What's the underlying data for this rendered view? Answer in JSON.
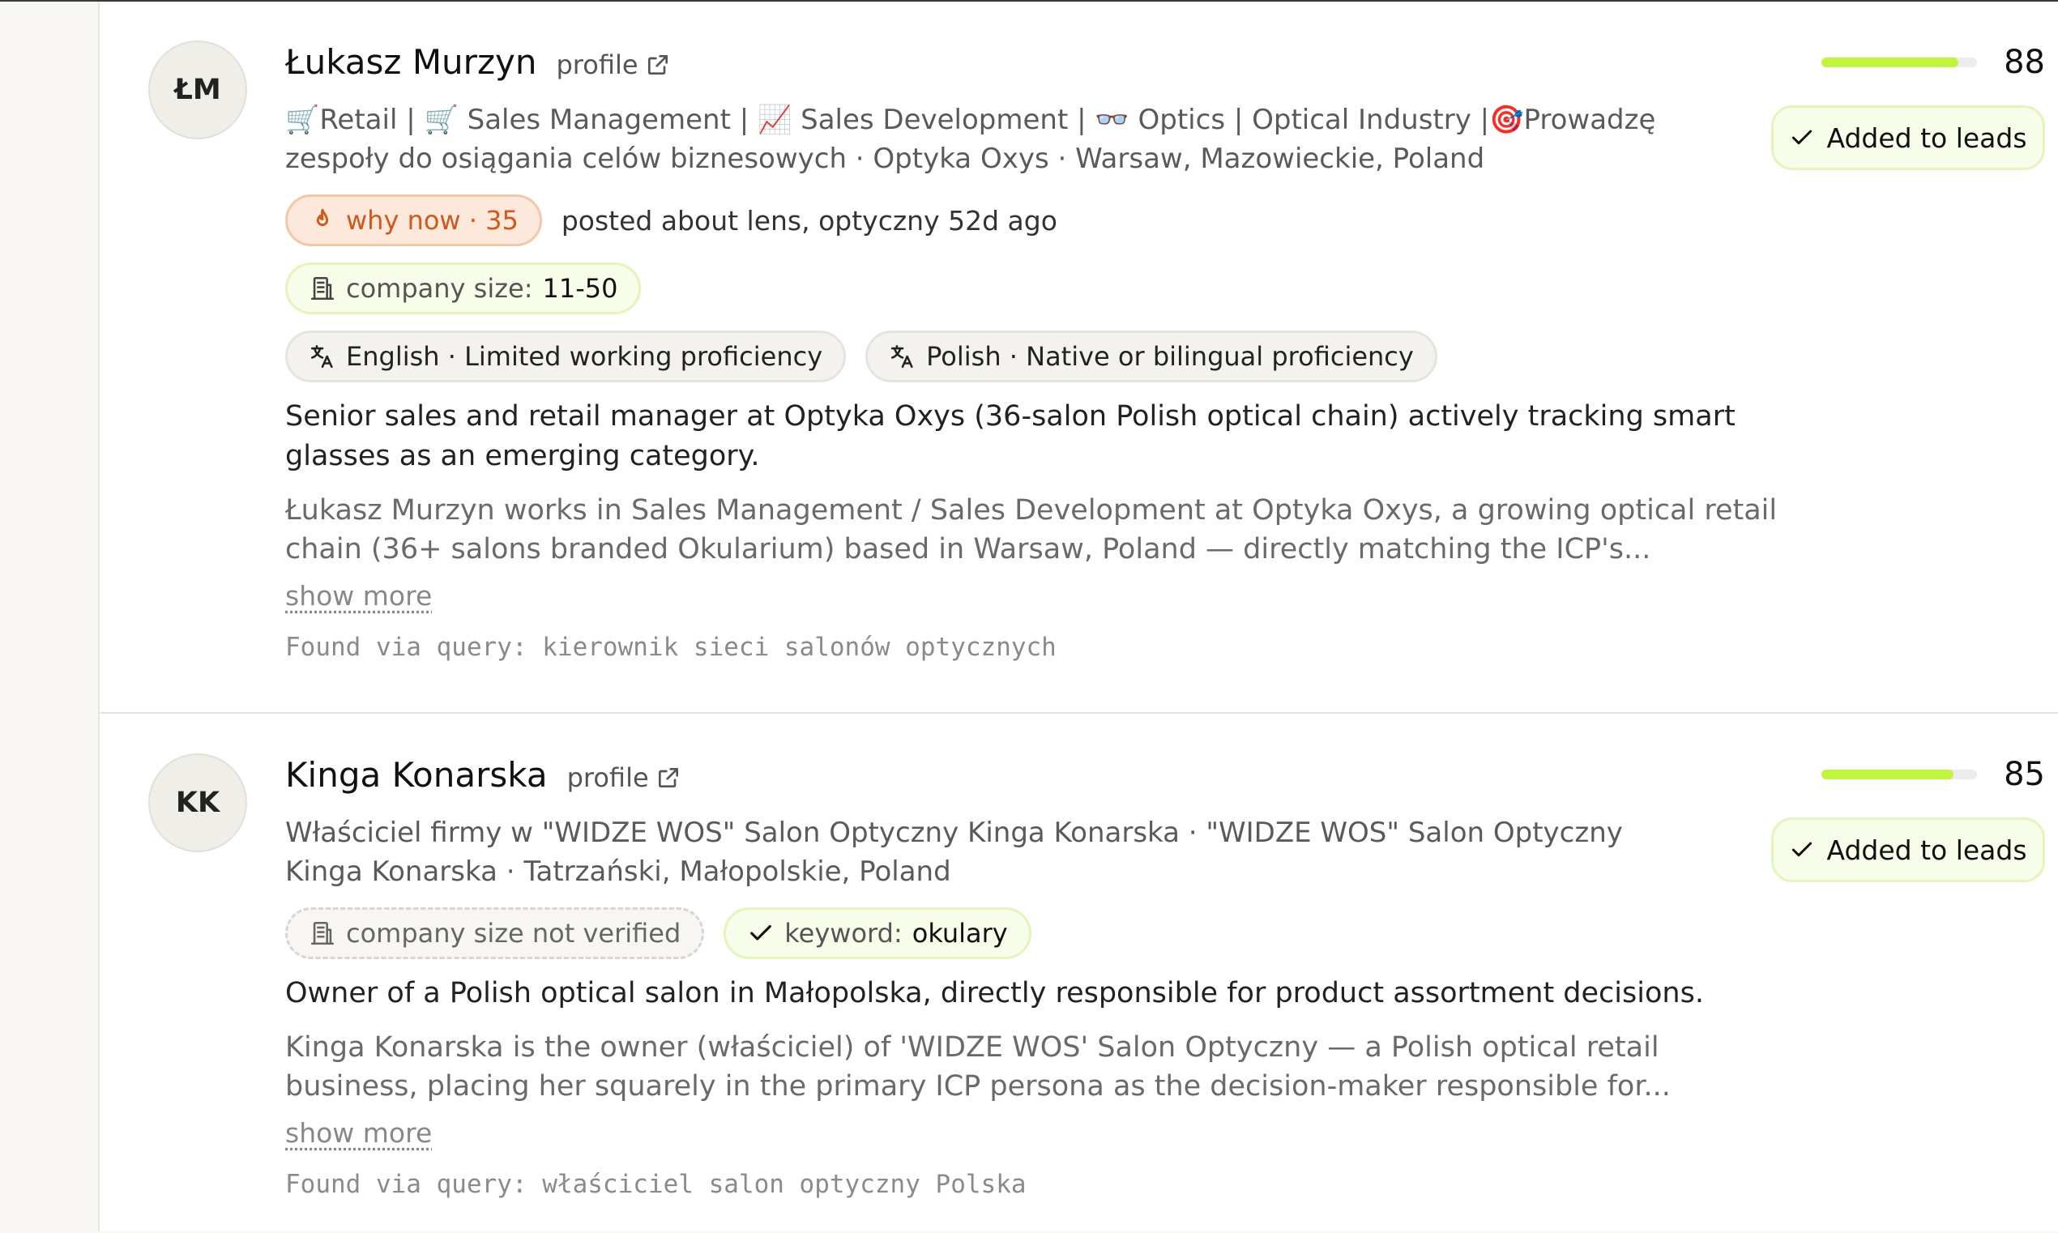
{
  "leads": [
    {
      "initials": "ŁM",
      "name": "Łukasz Murzyn",
      "profile_label": "profile",
      "headline": "🛒Retail | 🛒 Sales Management | 📈 Sales Development | 👓 Optics | Optical Industry |🎯Prowadzę zespoły do osiągania celów biznesowych · Optyka Oxys · Warsaw, Mazowieckie, Poland",
      "why_now_label": "why now · 35",
      "why_now_text": "posted about lens, optyczny 52d ago",
      "company_size_label": "company size:",
      "company_size_value": "11-50",
      "languages": [
        "English · Limited working proficiency",
        "Polish · Native or bilingual proficiency"
      ],
      "summary": "Senior sales and retail manager at Optyka Oxys (36-salon Polish optical chain) actively tracking smart glasses as an emerging category.",
      "detail": "Łukasz Murzyn works in Sales Management / Sales Development at Optyka Oxys, a growing optical retail chain (36+ salons branded Okularium) based in Warsaw, Poland — directly matching the ICP's...",
      "show_more": "show more",
      "query": "Found via query: kierownik sieci salonów optycznych",
      "score": "88",
      "score_fraction": 0.88,
      "leads_label": "Added to leads"
    },
    {
      "initials": "KK",
      "name": "Kinga Konarska",
      "profile_label": "profile",
      "headline": "Właściciel firmy w \"WIDZE WOS\" Salon Optyczny Kinga Konarska · \"WIDZE WOS\" Salon Optyczny Kinga Konarska · Tatrzański, Małopolskie, Poland",
      "company_size_unverified": "company size not verified",
      "keyword_label": "keyword:",
      "keyword_value": "okulary",
      "summary": "Owner of a Polish optical salon in Małopolska, directly responsible for product assortment decisions.",
      "detail": "Kinga Konarska is the owner (właściciel) of 'WIDZE WOS' Salon Optyczny — a Polish optical retail business, placing her squarely in the primary ICP persona as the decision-maker responsible for...",
      "show_more": "show more",
      "query": "Found via query: właściciel salon optyczny Polska",
      "score": "85",
      "score_fraction": 0.85,
      "leads_label": "Added to leads"
    }
  ],
  "colors": {
    "accent_green": "#bff53c",
    "why_now_orange": "#d2571a",
    "chip_green_bg": "#f7fde9"
  },
  "icons": [
    "external-link-icon",
    "flame-icon",
    "building-icon",
    "translate-icon",
    "check-icon"
  ]
}
